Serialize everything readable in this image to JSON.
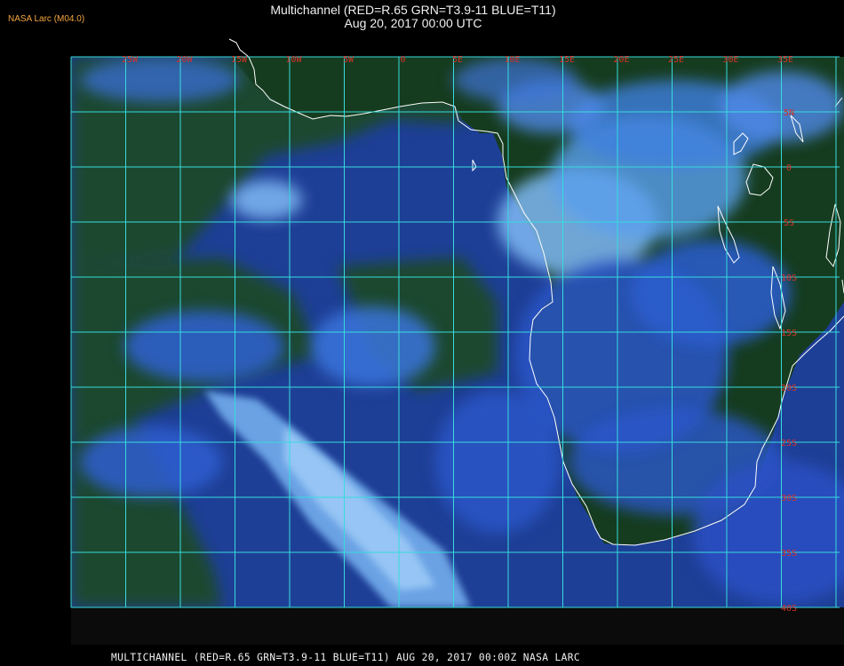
{
  "producer": "NASA Larc (M04.0)",
  "title": {
    "line1": "Multichannel (RED=R.65 GRN=T3.9-11 BLUE=T11)",
    "line2": "Aug 20, 2017 00:00 UTC"
  },
  "footer": "MULTICHANNEL (RED=R.65 GRN=T3.9-11 BLUE=T11) AUG 20, 2017 00:00Z   NASA LARC",
  "longitude_labels": [
    "25W",
    "20W",
    "15W",
    "10W",
    "5W",
    "0",
    "5E",
    "10E",
    "15E",
    "20E",
    "25E",
    "30E",
    "35E"
  ],
  "latitude_labels": [
    "5N",
    "0",
    "5S",
    "10S",
    "15S",
    "20S",
    "25S",
    "30S",
    "35S",
    "40S"
  ],
  "colors": {
    "grid": "#36dcdc",
    "ocean": "#1b3c9c",
    "land": "#153a1a",
    "cloud": "#6fb6f2",
    "coast": "#ffffff",
    "tick_labels": "#d9322b",
    "producer": "#f4a640"
  }
}
